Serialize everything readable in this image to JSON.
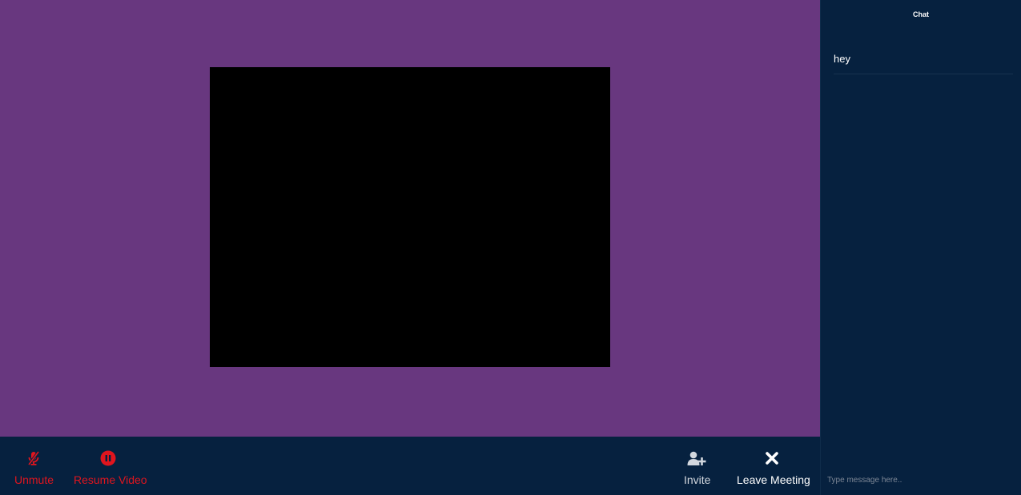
{
  "toolbar": {
    "unmute_label": "Unmute",
    "resume_video_label": "Resume Video",
    "invite_label": "Invite",
    "leave_label": "Leave Meeting"
  },
  "chat": {
    "title": "Chat",
    "messages": [
      {
        "text": "hey"
      }
    ],
    "input_placeholder": "Type message here.."
  },
  "colors": {
    "stage_background": "#68377f",
    "panel_background": "#06213f",
    "alert_red": "#e0151e"
  },
  "icons": {
    "unmute": "microphone-slash-icon",
    "resume_video": "pause-circle-icon",
    "invite": "user-plus-icon",
    "leave": "close-icon"
  }
}
